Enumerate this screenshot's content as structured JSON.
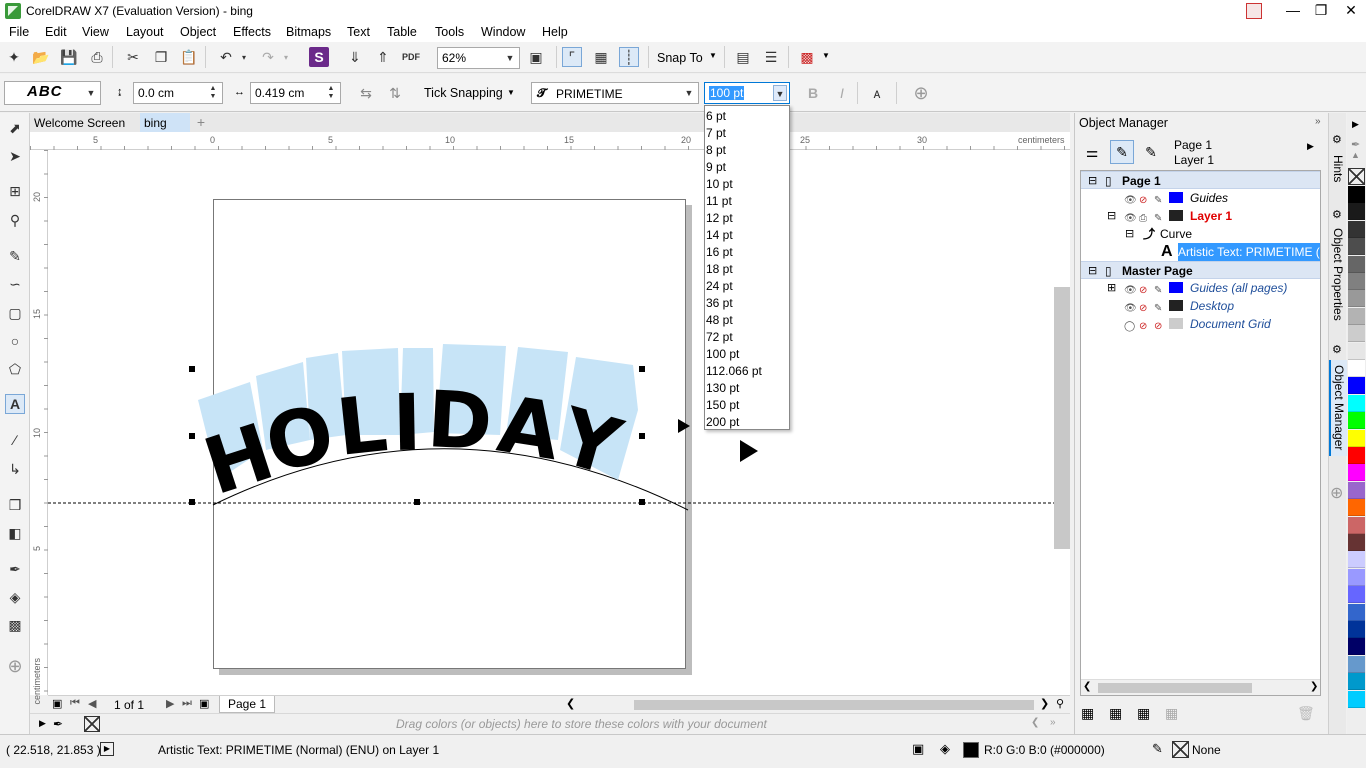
{
  "window": {
    "title": "CorelDRAW X7 (Evaluation Version) - bing"
  },
  "menu": [
    "File",
    "Edit",
    "View",
    "Layout",
    "Object",
    "Effects",
    "Bitmaps",
    "Text",
    "Table",
    "Tools",
    "Window",
    "Help"
  ],
  "toolbar": {
    "zoom": "62%",
    "snap_to": "Snap To"
  },
  "propertybar": {
    "x_offset": "0.0 cm",
    "y_offset": "0.419 cm",
    "tick_snapping": "Tick Snapping",
    "font_name": "PRIMETIME",
    "font_size": "100 pt"
  },
  "font_size_list": [
    "6 pt",
    "7 pt",
    "8 pt",
    "9 pt",
    "10 pt",
    "11 pt",
    "12 pt",
    "14 pt",
    "16 pt",
    "18 pt",
    "24 pt",
    "36 pt",
    "48 pt",
    "72 pt",
    "100 pt",
    "112.066 pt",
    "130 pt",
    "150 pt",
    "200 pt"
  ],
  "doc_tabs": [
    "Welcome Screen",
    "bing"
  ],
  "ruler": {
    "top_labels": [
      "5",
      "0",
      "5",
      "10",
      "15",
      "20",
      "25",
      "30"
    ],
    "left_labels": [
      "20",
      "15",
      "10",
      "5"
    ],
    "unit": "centimeters"
  },
  "canvas": {
    "text": "HOLIDAY"
  },
  "pagebar": {
    "page_count": "1 of 1",
    "page_tab": "Page 1"
  },
  "palettebar": {
    "hint": "Drag colors (or objects) here to store these colors with your document"
  },
  "object_manager": {
    "title": "Object Manager",
    "current_page": "Page 1",
    "current_layer": "Layer 1",
    "tree": {
      "page1": "Page 1",
      "guides": "Guides",
      "layer1": "Layer 1",
      "curve": "Curve",
      "artistic_text": "Artistic Text: PRIMETIME (N",
      "master_page": "Master Page",
      "guides_all": "Guides (all pages)",
      "desktop": "Desktop",
      "document_grid": "Document Grid"
    }
  },
  "side_tabs": [
    "Hints",
    "Object Properties",
    "Object Manager"
  ],
  "status": {
    "coords": "( 22.518, 21.853 )",
    "object_info": "Artistic Text: PRIMETIME (Normal) (ENU) on Layer 1",
    "fill_info": "R:0 G:0 B:0 (#000000)",
    "outline_info": "None"
  },
  "colors": {
    "accent": "#0078d7",
    "selection": "#3399ff",
    "banner": "#c7e4f7",
    "guides_swatch": "#0000ff",
    "layer_red": "#e00000"
  },
  "palette_colors": [
    "#000000",
    "#1a1a1a",
    "#333333",
    "#4d4d4d",
    "#666666",
    "#808080",
    "#999999",
    "#b3b3b3",
    "#cccccc",
    "#e6e6e6",
    "#ffffff",
    "#0000ff",
    "#00ffff",
    "#00ff00",
    "#ffff00",
    "#ff0000",
    "#ff00ff",
    "#9966cc",
    "#ff6600",
    "#cc6666",
    "#663333",
    "#ccccff",
    "#9999ff",
    "#6666ff",
    "#3366cc",
    "#003399",
    "#000066",
    "#6699cc",
    "#0099cc",
    "#00ccff"
  ]
}
